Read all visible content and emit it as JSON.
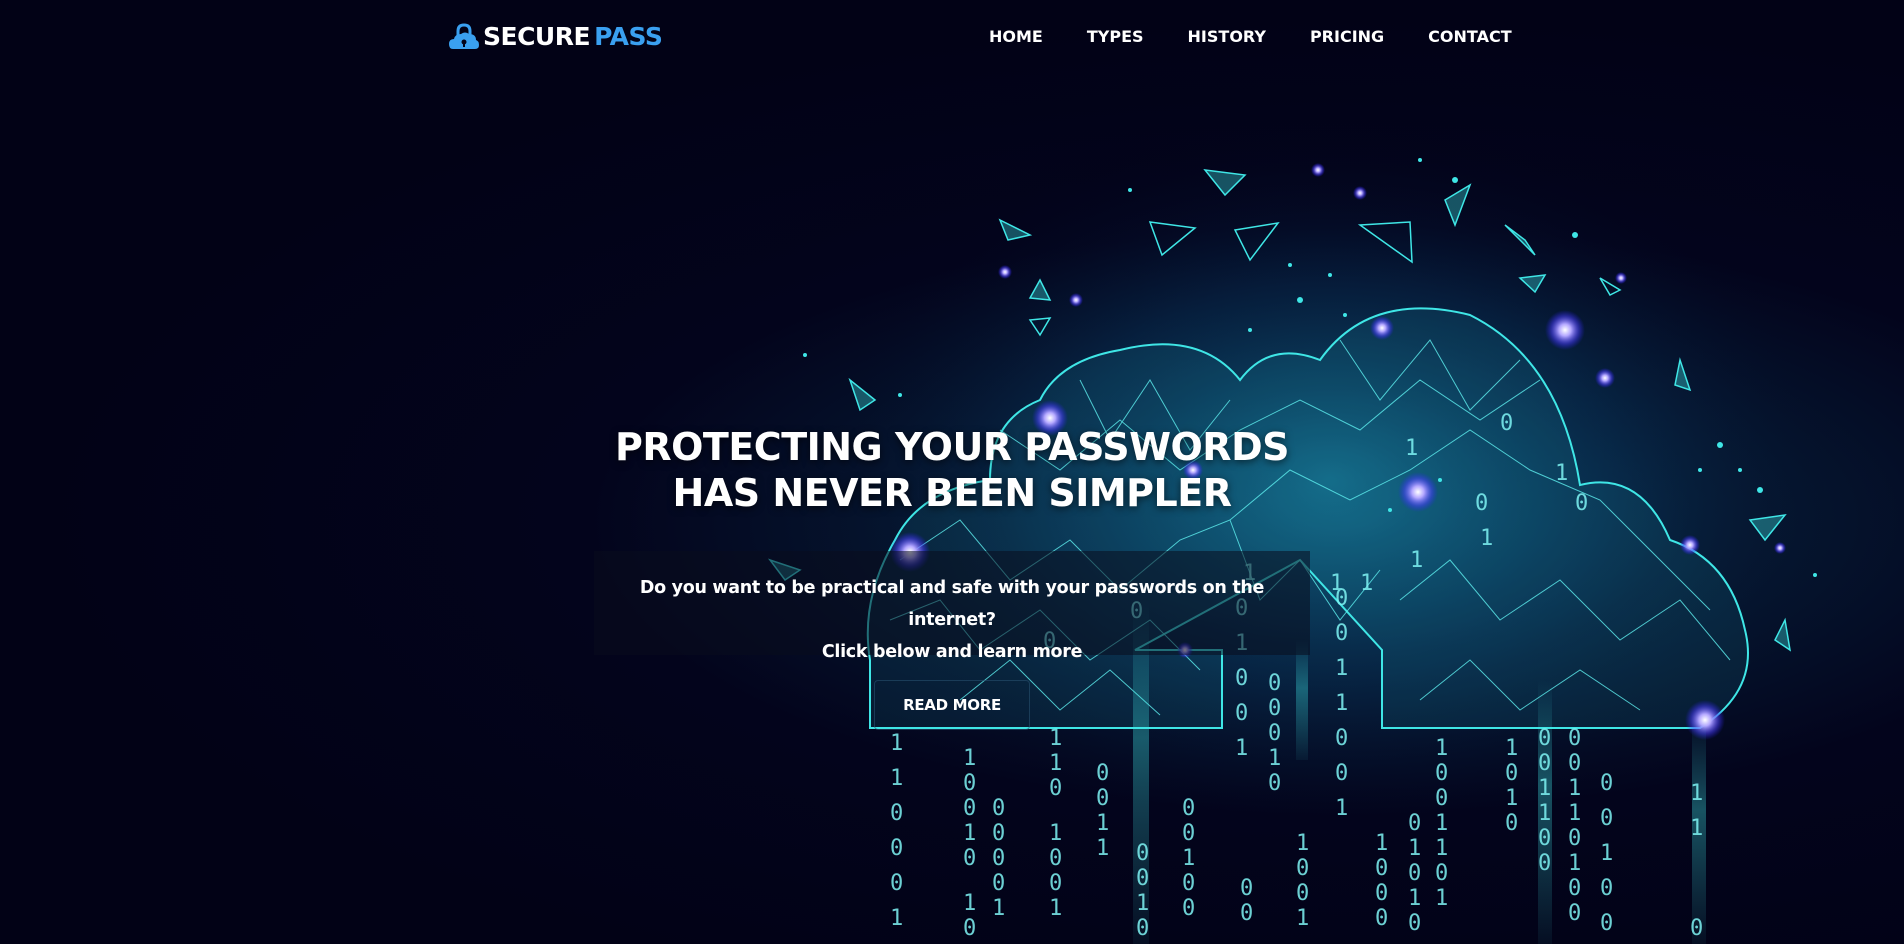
{
  "header": {
    "logo": {
      "part1": "SECURE",
      "part2": "PASS",
      "icon": "cloud-lock-icon"
    },
    "nav": [
      {
        "label": "HOME"
      },
      {
        "label": "TYPES"
      },
      {
        "label": "HISTORY"
      },
      {
        "label": "PRICING"
      },
      {
        "label": "CONTACT"
      }
    ]
  },
  "hero": {
    "title_line1": "PROTECTING YOUR PASSWORDS",
    "title_line2": "HAS NEVER BEEN SIMPLER",
    "subtitle_line1": "Do you want to be practical and safe with your passwords on the internet?",
    "subtitle_line2": "Click below and learn more",
    "button_label": "READ MORE",
    "background_image": "cloud-security-binary-illustration"
  },
  "colors": {
    "background": "#03031a",
    "accent": "#3aa0f0",
    "cyan": "#3fe6e6",
    "text": "#ffffff"
  }
}
